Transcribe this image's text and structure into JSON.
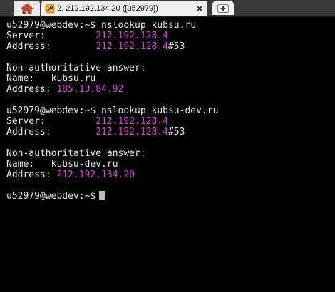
{
  "tabs": {
    "home_icon": "home-icon",
    "session": {
      "icon": "wrench-icon",
      "title": "2. 212.192.134.20 ([u52979])",
      "close_icon": "close-icon"
    },
    "new_tab_icon": "plus-icon"
  },
  "terminal": {
    "colors": {
      "text": "#e6e6e6",
      "highlight": "#e23ee3",
      "background": "#000000"
    },
    "line1": {
      "text": "u52979@webdev:~$ nslookup kubsu.ru"
    },
    "line2": {
      "label": "Server:         ",
      "value": "212.192.128.4"
    },
    "line3": {
      "label": "Address:        ",
      "value": "212.192.128.4",
      "suffix": "#53"
    },
    "line4": {
      "text": ""
    },
    "line5": {
      "text": "Non-authoritative answer:"
    },
    "line6": {
      "text": "Name:   kubsu.ru"
    },
    "line7": {
      "label": "Address: ",
      "value": "185.13.84.92"
    },
    "line8": {
      "text": ""
    },
    "line9": {
      "text": "u52979@webdev:~$ nslookup kubsu-dev.ru"
    },
    "line10": {
      "label": "Server:         ",
      "value": "212.192.128.4"
    },
    "line11": {
      "label": "Address:        ",
      "value": "212.192.128.4",
      "suffix": "#53"
    },
    "line12": {
      "text": ""
    },
    "line13": {
      "text": "Non-authoritative answer:"
    },
    "line14": {
      "text": "Name:   kubsu-dev.ru"
    },
    "line15": {
      "label": "Address: ",
      "value": "212.192.134.20"
    },
    "line16": {
      "text": ""
    },
    "line17": {
      "text": "u52979@webdev:~$"
    }
  }
}
